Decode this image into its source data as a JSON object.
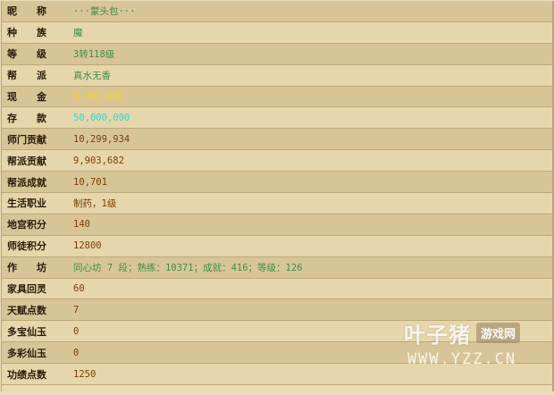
{
  "rows": [
    {
      "label": "昵称",
      "value": "···蒙头包···",
      "color": "#3d8f4a"
    },
    {
      "label": "种族",
      "value": "魔",
      "color": "#3d8f4a"
    },
    {
      "label": "等级",
      "value": "3转118级",
      "color": "#3d8f4a"
    },
    {
      "label": "帮派",
      "value": "真水无香",
      "color": "#3d8f4a"
    },
    {
      "label": "现金",
      "value": "1,493,962",
      "color": "#f5d31f"
    },
    {
      "label": "存款",
      "value": "50,000,000",
      "color": "#35d5d2"
    },
    {
      "label": "师门贡献",
      "value": "10,299,934",
      "color": "#7a3f04"
    },
    {
      "label": "帮派贡献",
      "value": "9,903,682",
      "color": "#7a3f04"
    },
    {
      "label": "帮派成就",
      "value": "10,701",
      "color": "#7a3f04"
    },
    {
      "label": "生活职业",
      "value": "制药，1级",
      "color": "#7a3f04"
    },
    {
      "label": "地宫积分",
      "value": "140",
      "color": "#7a3f04"
    },
    {
      "label": "师徒积分",
      "value": "12800",
      "color": "#7a3f04"
    },
    {
      "label": "作坊",
      "value": "同心坊 7 段；熟练：10371；成就：416；等级：126",
      "color": "#3d8f4a"
    },
    {
      "label": "家具回灵",
      "value": "60",
      "color": "#7a3f04"
    },
    {
      "label": "天赋点数",
      "value": "7",
      "color": "#7a3f04"
    },
    {
      "label": "多宝仙玉",
      "value": "0",
      "color": "#7a3f04"
    },
    {
      "label": "多彩仙玉",
      "value": "0",
      "color": "#7a3f04"
    },
    {
      "label": "功绩点数",
      "value": "1250",
      "color": "#7a3f04"
    }
  ],
  "watermark": {
    "brand": "叶子猪",
    "tag": "游戏网",
    "url": "WWW.YZZ.CN"
  }
}
